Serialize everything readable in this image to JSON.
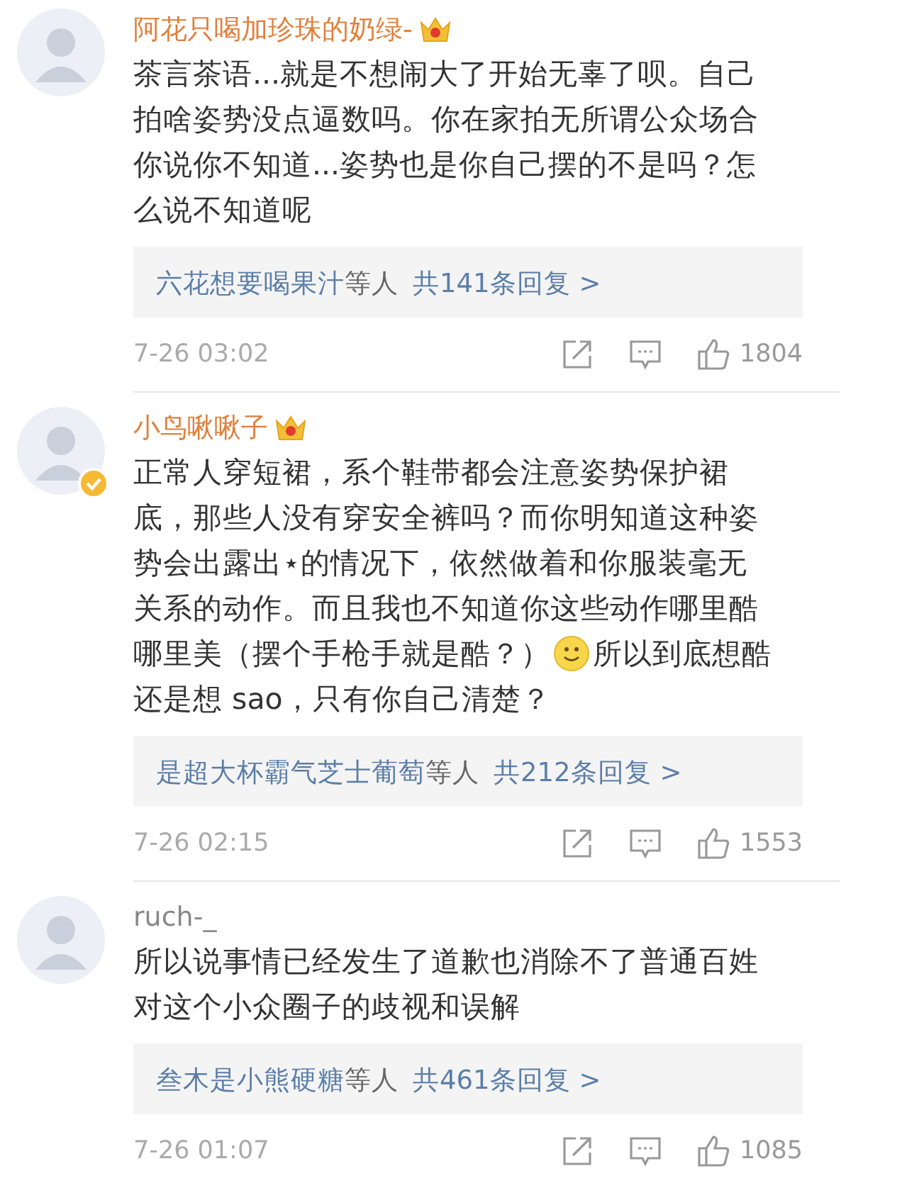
{
  "comments": [
    {
      "name": "阿花只喝加珍珠的奶绿-",
      "vip": true,
      "verified": false,
      "lines": [
        [
          {
            "kind": "text",
            "text": "茶言茶语...就是不想闹大了开始无辜了呗。自己"
          }
        ],
        [
          {
            "kind": "text",
            "text": "拍啥姿势没点逼数吗。你在家拍无所谓公众场合"
          }
        ],
        [
          {
            "kind": "text",
            "text": "你说你不知道...姿势也是你自己摆的不是吗？怎"
          }
        ],
        [
          {
            "kind": "text",
            "text": "么说不知道呢"
          }
        ]
      ],
      "replies": {
        "replier": "六花想要喝果汁",
        "suffix": "等人",
        "count": "共141条回复 >"
      },
      "time": "7-26 03:02",
      "likes": "1804"
    },
    {
      "name": "小鸟啾啾子",
      "vip": true,
      "verified": true,
      "lines": [
        [
          {
            "kind": "text",
            "text": "正常人穿短裙，系个鞋带都会注意姿势保护裙"
          }
        ],
        [
          {
            "kind": "text",
            "text": "底，那些人没有穿安全裤吗？而你明知道这种姿"
          }
        ],
        [
          {
            "kind": "text",
            "text": "势会出露出⋆的情况下，依然做着和你服装毫无"
          }
        ],
        [
          {
            "kind": "text",
            "text": "关系的动作。而且我也不知道你这些动作哪里酷"
          }
        ],
        [
          {
            "kind": "text",
            "text": "哪里美（摆个手枪手就是酷？）"
          },
          {
            "kind": "emoji"
          },
          {
            "kind": "text",
            "text": "所以到底想酷"
          }
        ],
        [
          {
            "kind": "text",
            "text": "还是想 sao，只有你自己清楚？"
          }
        ]
      ],
      "replies": {
        "replier": "是超大杯霸气芝士葡萄",
        "suffix": "等人",
        "count": "共212条回复 >"
      },
      "time": "7-26 02:15",
      "likes": "1553"
    },
    {
      "name": "ruch-_",
      "vip": false,
      "verified": false,
      "lines": [
        [
          {
            "kind": "text",
            "text": "所以说事情已经发生了道歉也消除不了普通百姓"
          }
        ],
        [
          {
            "kind": "text",
            "text": "对这个小众圈子的歧视和误解"
          }
        ]
      ],
      "replies": {
        "replier": "叁木是小熊硬糖",
        "suffix": "等人",
        "count": "共461条回复 >"
      },
      "time": "7-26 01:07",
      "likes": "1085"
    }
  ]
}
